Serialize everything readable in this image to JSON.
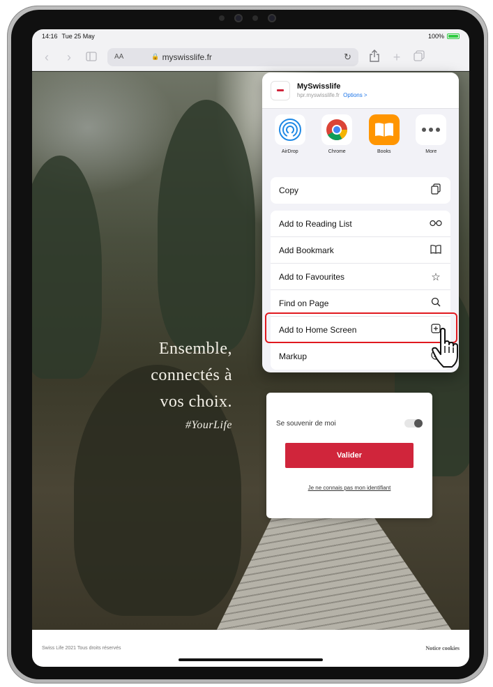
{
  "status_bar": {
    "time": "14:16",
    "date": "Tue 25 May",
    "battery": "100%"
  },
  "toolbar": {
    "aa_label": "AA",
    "url": "myswisslife.fr"
  },
  "hero": {
    "line1": "Ensemble,",
    "line2": "connectés à",
    "line3": "vos choix.",
    "hashtag": "#YourLife"
  },
  "login": {
    "remember_label": "Se souvenir de moi",
    "submit_label": "Valider",
    "forgot_link": "Je ne connais pas mon identifiant"
  },
  "footer": {
    "copyright": "Swiss Life 2021 Tous droits réservés",
    "cookies": "Notice cookies"
  },
  "share_sheet": {
    "title": "MySwisslife",
    "subtitle": "hpr.myswisslife.fr",
    "options_label": "Options >",
    "apps": [
      {
        "label": "AirDrop",
        "icon": "airdrop-icon"
      },
      {
        "label": "Chrome",
        "icon": "chrome-icon"
      },
      {
        "label": "Books",
        "icon": "books-icon"
      },
      {
        "label": "More",
        "icon": "more-icon"
      }
    ],
    "copy_label": "Copy",
    "actions": [
      {
        "label": "Add to Reading List",
        "icon": "glasses-icon"
      },
      {
        "label": "Add Bookmark",
        "icon": "book-icon"
      },
      {
        "label": "Add to Favourites",
        "icon": "star-icon"
      },
      {
        "label": "Find on Page",
        "icon": "search-icon"
      },
      {
        "label": "Add to Home Screen",
        "icon": "plus-square-icon"
      },
      {
        "label": "Markup",
        "icon": "markup-icon"
      }
    ]
  },
  "colors": {
    "brand_red": "#d0253b",
    "highlight": "#e0191f",
    "link_blue": "#1a73e8"
  }
}
